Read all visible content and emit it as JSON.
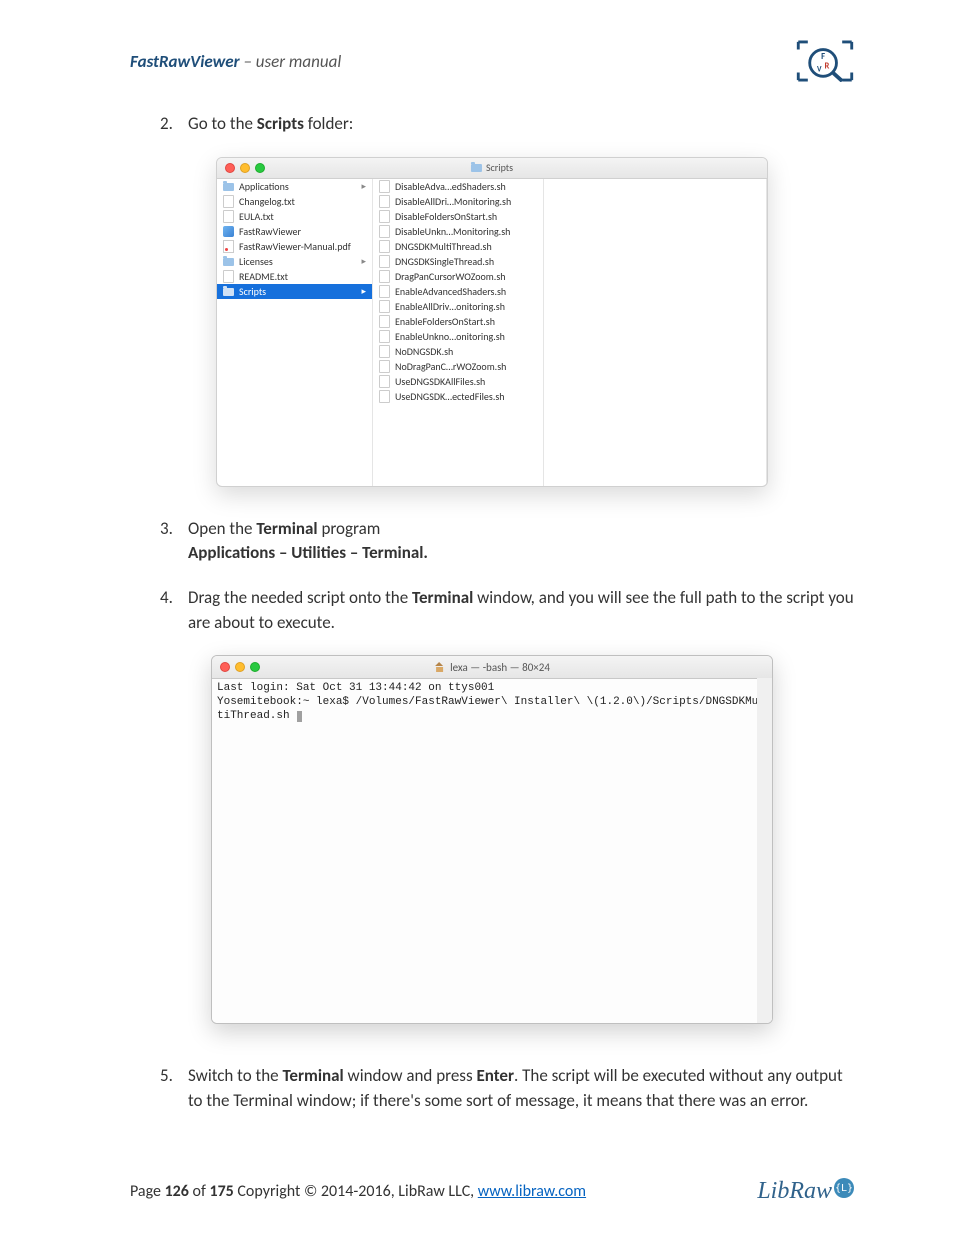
{
  "header": {
    "app_name": "FastRawViewer",
    "suffix": " – user manual"
  },
  "steps": {
    "s2_pre": "Go to the ",
    "s2_bold": "Scripts",
    "s2_post": " folder:",
    "s3_pre": "Open the ",
    "s3_bold": "Terminal",
    "s3_post": " program",
    "s3b": "Applications – Utilities – Terminal.",
    "s4_pre": "Drag the needed script onto the ",
    "s4_bold": "Terminal",
    "s4_post": " window, and you will see the full path to the script you are about to execute.",
    "s5_pre": "Switch to the ",
    "s5_bold1": "Terminal",
    "s5_mid": " window and press ",
    "s5_bold2": "Enter",
    "s5_post": ". The script will be executed without any output to the Terminal window; if there's some sort of message, it means that there was an error."
  },
  "finder": {
    "title": "Scripts",
    "left": [
      {
        "label": "Applications",
        "icon": "i-folder",
        "chev": true
      },
      {
        "label": "Changelog.txt",
        "icon": "i-doc"
      },
      {
        "label": "EULA.txt",
        "icon": "i-doc"
      },
      {
        "label": "FastRawViewer",
        "icon": "i-app"
      },
      {
        "label": "FastRawViewer-Manual.pdf",
        "icon": "i-pdf"
      },
      {
        "label": "Licenses",
        "icon": "i-folder",
        "chev": true
      },
      {
        "label": "README.txt",
        "icon": "i-doc"
      },
      {
        "label": "Scripts",
        "icon": "i-folder sel",
        "chev": true,
        "selected": true
      }
    ],
    "right": [
      "DisableAdva…edShaders.sh",
      "DisableAllDri…Monitoring.sh",
      "DisableFoldersOnStart.sh",
      "DisableUnkn…Monitoring.sh",
      "DNGSDKMultiThread.sh",
      "DNGSDKSingleThread.sh",
      "DragPanCursorWOZoom.sh",
      "EnableAdvancedShaders.sh",
      "EnableAllDriv…onitoring.sh",
      "EnableFoldersOnStart.sh",
      "EnableUnkno…onitoring.sh",
      "NoDNGSDK.sh",
      "NoDragPanC…rWOZoom.sh",
      "UseDNGSDKAllFiles.sh",
      "UseDNGSDK…ectedFiles.sh"
    ]
  },
  "terminal": {
    "title": "lexa — -bash — 80×24",
    "line1": "Last login: Sat Oct 31 13:44:42 on ttys001",
    "line2": "Yosemitebook:~ lexa$ /Volumes/FastRawViewer\\ Installer\\ \\(1.2.0\\)/Scripts/DNGSDKMultiThread.sh "
  },
  "footer": {
    "page_pre": "Page ",
    "page_current": "126",
    "page_mid": " of ",
    "page_total": "175",
    "copyright": " Copyright © 2014-2016, LibRaw LLC, ",
    "url": "www.libraw.com",
    "libraw_text": "LibRaw",
    "libraw_bubble": "{L}"
  }
}
